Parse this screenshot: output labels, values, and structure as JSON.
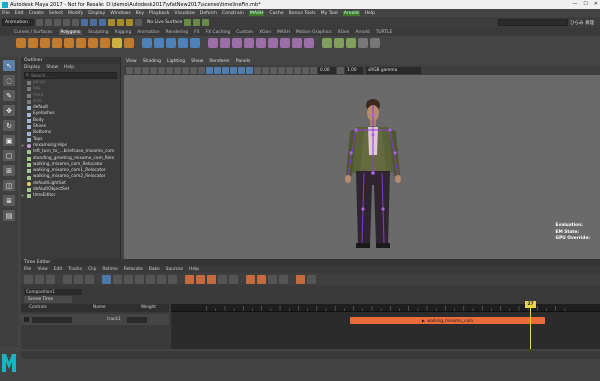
{
  "window": {
    "title": "Autodesk Maya 2017 - Not for Resale: D:\\demo\\Autodesk2017\\vfatNew2017\\scenes\\timelineFin.mb*",
    "controls": [
      "—",
      "☐",
      "✕"
    ]
  },
  "menubar": {
    "items": [
      "File",
      "Edit",
      "Create",
      "Select",
      "Modify",
      "Display",
      "Windows",
      "Key",
      "Playback",
      "Visualize",
      "Deform",
      "Constrain",
      "MASH",
      "Cache",
      "Bonus Tools",
      "My Tool",
      "Arnold",
      "Help"
    ],
    "highlighted": [
      "MASH",
      "Arnold"
    ]
  },
  "statusline": {
    "mode": "Animation",
    "no_live": "No Live Surface",
    "user_label": "ひらみ 真理"
  },
  "shelf_tabs": {
    "items": [
      "Curves / Surfaces",
      "Polygons",
      "Sculpting",
      "Rigging",
      "Animation",
      "Rendering",
      "FX",
      "FX Caching",
      "Custom",
      "XGen",
      "MASH",
      "Motion Graphics",
      "XGen",
      "Arnold",
      "TURTLE"
    ],
    "active": "Polygons"
  },
  "outliner": {
    "title": "Outliner",
    "menu": [
      "Display",
      "Show",
      "Help"
    ],
    "search_placeholder": "Search...",
    "items": [
      {
        "label": "persp",
        "icon": "camera",
        "dim": true,
        "expand": false
      },
      {
        "label": "top",
        "icon": "camera",
        "dim": true,
        "expand": false
      },
      {
        "label": "front",
        "icon": "camera",
        "dim": true,
        "expand": false
      },
      {
        "label": "side",
        "icon": "camera",
        "dim": true,
        "expand": false
      },
      {
        "label": "default",
        "icon": "mesh",
        "dim": false,
        "expand": false
      },
      {
        "label": "Eyelashes",
        "icon": "mesh",
        "dim": false,
        "expand": false
      },
      {
        "label": "Body",
        "icon": "mesh",
        "dim": false,
        "expand": false
      },
      {
        "label": "Shoes",
        "icon": "mesh",
        "dim": false,
        "expand": false
      },
      {
        "label": "Bottoms",
        "icon": "mesh",
        "dim": false,
        "expand": false
      },
      {
        "label": "Tops",
        "icon": "mesh",
        "dim": false,
        "expand": false
      },
      {
        "label": "mixamorig:Hips",
        "icon": "joint",
        "dim": false,
        "expand": true
      },
      {
        "label": "left_turn_to_...briefcase_mixamo_com",
        "icon": "set",
        "dim": false,
        "expand": false
      },
      {
        "label": "standing_greeting_mixamo_com_Relo",
        "icon": "set",
        "dim": false,
        "expand": false
      },
      {
        "label": "walking_mixamo_com_Relocator",
        "icon": "set",
        "dim": false,
        "expand": false
      },
      {
        "label": "walking_mixamo_com1_Relocator",
        "icon": "set",
        "dim": false,
        "expand": false
      },
      {
        "label": "walking_mixamo_com2_Relocator",
        "icon": "set",
        "dim": false,
        "expand": false
      },
      {
        "label": "defaultLightSet",
        "icon": "light",
        "dim": false,
        "expand": false
      },
      {
        "label": "defaultObjectSet",
        "icon": "set",
        "dim": false,
        "expand": false
      },
      {
        "label": "timeEditor",
        "icon": "set",
        "dim": false,
        "expand": true
      }
    ]
  },
  "viewport": {
    "menu": [
      "View",
      "Shading",
      "Lighting",
      "Show",
      "Renderer",
      "Panels"
    ],
    "exposure": "0.00",
    "gamma": "1.00",
    "color_space": "sRGB gamma",
    "hud": [
      "Evaluation:",
      "EM State:",
      "GPU Override:"
    ]
  },
  "time_editor": {
    "title": "Time Editor",
    "menu": [
      "File",
      "View",
      "Edit",
      "Tracks",
      "Clip",
      "Retime",
      "Relocate",
      "Bake",
      "Sources",
      "Help"
    ],
    "composition": "Composition1",
    "scene_time": "Scene Time",
    "columns": {
      "controls": "Controls",
      "name": "Name",
      "weight": "Weight"
    },
    "track_name": "track1",
    "clip_label": "walking_mixamo_com",
    "current_frame": "27"
  }
}
